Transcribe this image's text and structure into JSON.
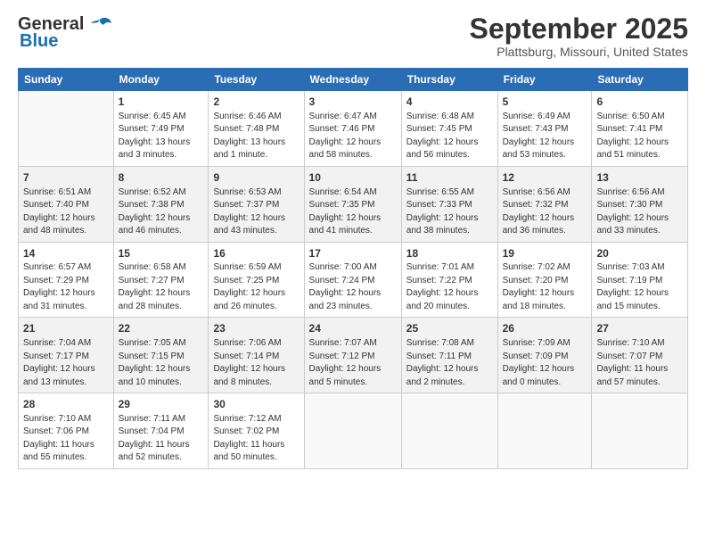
{
  "logo": {
    "line1": "General",
    "line2": "Blue"
  },
  "title": "September 2025",
  "location": "Plattsburg, Missouri, United States",
  "weekdays": [
    "Sunday",
    "Monday",
    "Tuesday",
    "Wednesday",
    "Thursday",
    "Friday",
    "Saturday"
  ],
  "weeks": [
    [
      {
        "day": "",
        "info": ""
      },
      {
        "day": "1",
        "info": "Sunrise: 6:45 AM\nSunset: 7:49 PM\nDaylight: 13 hours\nand 3 minutes."
      },
      {
        "day": "2",
        "info": "Sunrise: 6:46 AM\nSunset: 7:48 PM\nDaylight: 13 hours\nand 1 minute."
      },
      {
        "day": "3",
        "info": "Sunrise: 6:47 AM\nSunset: 7:46 PM\nDaylight: 12 hours\nand 58 minutes."
      },
      {
        "day": "4",
        "info": "Sunrise: 6:48 AM\nSunset: 7:45 PM\nDaylight: 12 hours\nand 56 minutes."
      },
      {
        "day": "5",
        "info": "Sunrise: 6:49 AM\nSunset: 7:43 PM\nDaylight: 12 hours\nand 53 minutes."
      },
      {
        "day": "6",
        "info": "Sunrise: 6:50 AM\nSunset: 7:41 PM\nDaylight: 12 hours\nand 51 minutes."
      }
    ],
    [
      {
        "day": "7",
        "info": "Sunrise: 6:51 AM\nSunset: 7:40 PM\nDaylight: 12 hours\nand 48 minutes."
      },
      {
        "day": "8",
        "info": "Sunrise: 6:52 AM\nSunset: 7:38 PM\nDaylight: 12 hours\nand 46 minutes."
      },
      {
        "day": "9",
        "info": "Sunrise: 6:53 AM\nSunset: 7:37 PM\nDaylight: 12 hours\nand 43 minutes."
      },
      {
        "day": "10",
        "info": "Sunrise: 6:54 AM\nSunset: 7:35 PM\nDaylight: 12 hours\nand 41 minutes."
      },
      {
        "day": "11",
        "info": "Sunrise: 6:55 AM\nSunset: 7:33 PM\nDaylight: 12 hours\nand 38 minutes."
      },
      {
        "day": "12",
        "info": "Sunrise: 6:56 AM\nSunset: 7:32 PM\nDaylight: 12 hours\nand 36 minutes."
      },
      {
        "day": "13",
        "info": "Sunrise: 6:56 AM\nSunset: 7:30 PM\nDaylight: 12 hours\nand 33 minutes."
      }
    ],
    [
      {
        "day": "14",
        "info": "Sunrise: 6:57 AM\nSunset: 7:29 PM\nDaylight: 12 hours\nand 31 minutes."
      },
      {
        "day": "15",
        "info": "Sunrise: 6:58 AM\nSunset: 7:27 PM\nDaylight: 12 hours\nand 28 minutes."
      },
      {
        "day": "16",
        "info": "Sunrise: 6:59 AM\nSunset: 7:25 PM\nDaylight: 12 hours\nand 26 minutes."
      },
      {
        "day": "17",
        "info": "Sunrise: 7:00 AM\nSunset: 7:24 PM\nDaylight: 12 hours\nand 23 minutes."
      },
      {
        "day": "18",
        "info": "Sunrise: 7:01 AM\nSunset: 7:22 PM\nDaylight: 12 hours\nand 20 minutes."
      },
      {
        "day": "19",
        "info": "Sunrise: 7:02 AM\nSunset: 7:20 PM\nDaylight: 12 hours\nand 18 minutes."
      },
      {
        "day": "20",
        "info": "Sunrise: 7:03 AM\nSunset: 7:19 PM\nDaylight: 12 hours\nand 15 minutes."
      }
    ],
    [
      {
        "day": "21",
        "info": "Sunrise: 7:04 AM\nSunset: 7:17 PM\nDaylight: 12 hours\nand 13 minutes."
      },
      {
        "day": "22",
        "info": "Sunrise: 7:05 AM\nSunset: 7:15 PM\nDaylight: 12 hours\nand 10 minutes."
      },
      {
        "day": "23",
        "info": "Sunrise: 7:06 AM\nSunset: 7:14 PM\nDaylight: 12 hours\nand 8 minutes."
      },
      {
        "day": "24",
        "info": "Sunrise: 7:07 AM\nSunset: 7:12 PM\nDaylight: 12 hours\nand 5 minutes."
      },
      {
        "day": "25",
        "info": "Sunrise: 7:08 AM\nSunset: 7:11 PM\nDaylight: 12 hours\nand 2 minutes."
      },
      {
        "day": "26",
        "info": "Sunrise: 7:09 AM\nSunset: 7:09 PM\nDaylight: 12 hours\nand 0 minutes."
      },
      {
        "day": "27",
        "info": "Sunrise: 7:10 AM\nSunset: 7:07 PM\nDaylight: 11 hours\nand 57 minutes."
      }
    ],
    [
      {
        "day": "28",
        "info": "Sunrise: 7:10 AM\nSunset: 7:06 PM\nDaylight: 11 hours\nand 55 minutes."
      },
      {
        "day": "29",
        "info": "Sunrise: 7:11 AM\nSunset: 7:04 PM\nDaylight: 11 hours\nand 52 minutes."
      },
      {
        "day": "30",
        "info": "Sunrise: 7:12 AM\nSunset: 7:02 PM\nDaylight: 11 hours\nand 50 minutes."
      },
      {
        "day": "",
        "info": ""
      },
      {
        "day": "",
        "info": ""
      },
      {
        "day": "",
        "info": ""
      },
      {
        "day": "",
        "info": ""
      }
    ]
  ]
}
